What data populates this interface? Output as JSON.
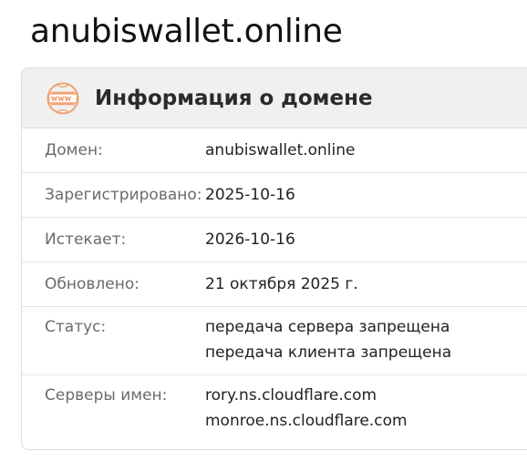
{
  "page": {
    "title": "anubiswallet.online"
  },
  "card": {
    "title": "Информация о домене",
    "icon": "www-icon",
    "accent_color": "#f0a070"
  },
  "rows": {
    "domain": {
      "label": "Домен:",
      "value": "anubiswallet.online"
    },
    "registered": {
      "label": "Зарегистрировано:",
      "value": "2025-10-16"
    },
    "expires": {
      "label": "Истекает:",
      "value": "2026-10-16"
    },
    "updated": {
      "label": "Обновлено:",
      "value": "21 октября 2025 г."
    },
    "status": {
      "label": "Статус:",
      "values": [
        "передача сервера запрещена",
        "передача клиента запрещена"
      ]
    },
    "nameservers": {
      "label": "Серверы имен:",
      "values": [
        "rory.ns.cloudflare.com",
        "monroe.ns.cloudflare.com"
      ]
    }
  }
}
